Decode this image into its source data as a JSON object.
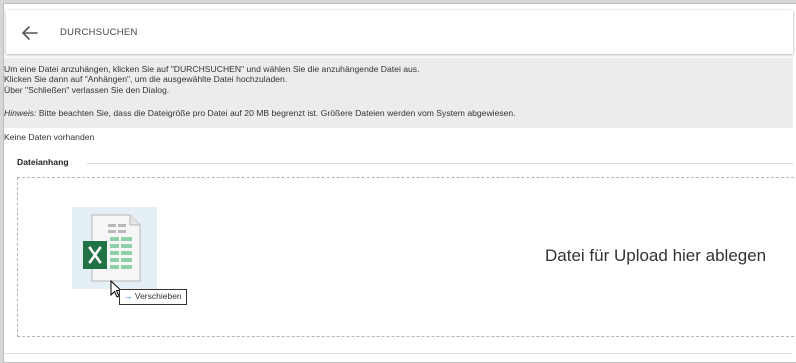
{
  "toolbar": {
    "back_icon": "arrow-left-icon",
    "browse_label": "DURCHSUCHEN"
  },
  "info": {
    "lines": [
      "Um eine Datei anzuhängen, klicken Sie auf \"DURCHSUCHEN\" und wählen Sie die anzuhängende Datei aus.",
      "Klicken Sie dann auf \"Anhängen\", um die ausgewählte Datei hochzuladen.",
      "Über \"Schließen\" verlassen Sie den Dialog."
    ],
    "hint_label": "Hinweis:",
    "hint_text": " Bitte beachten Sie, dass die Dateigröße pro Datei auf 20 MB begrenzt ist. Größere Dateien werden vom System abgewiesen."
  },
  "empty_text": "Keine Daten vorhanden",
  "attachment": {
    "title": "Dateianhang",
    "drop_text": "Datei für Upload hier ablegen"
  },
  "drag": {
    "file_icon": "excel-file-icon",
    "tooltip_arrow": "→",
    "tooltip_label": "Verschieben"
  },
  "colors": {
    "excel_green": "#217346",
    "info_bg": "#ececec",
    "tooltip_arrow": "#1f5bd6"
  }
}
